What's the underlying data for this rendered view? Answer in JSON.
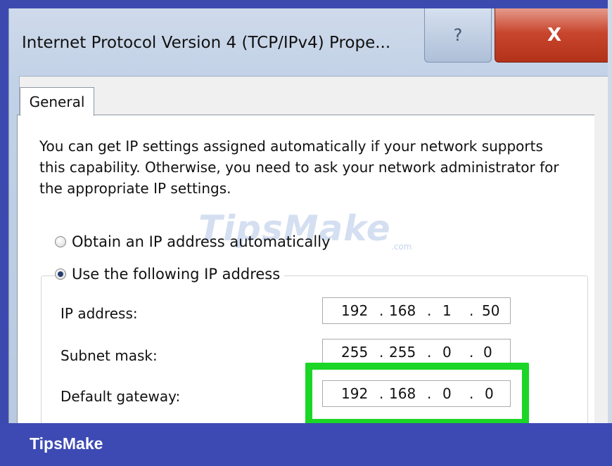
{
  "window": {
    "title": "Internet Protocol Version 4 (TCP/IPv4) Prope...",
    "help_glyph": "?",
    "close_glyph": "X"
  },
  "tabs": [
    {
      "label": "General",
      "selected": true
    }
  ],
  "description": "You can get IP settings assigned automatically if your network supports this capability. Otherwise, you need to ask your network administrator for the appropriate IP settings.",
  "radios": {
    "auto": {
      "label": "Obtain an IP address automatically",
      "checked": false
    },
    "manual": {
      "label": "Use the following IP address",
      "checked": true
    }
  },
  "fields": {
    "ip_address": {
      "label": "IP address:",
      "octets": [
        "192",
        "168",
        "1",
        "50"
      ]
    },
    "subnet_mask": {
      "label": "Subnet mask:",
      "octets": [
        "255",
        "255",
        "0",
        "0"
      ]
    },
    "default_gateway": {
      "label": "Default gateway:",
      "octets": [
        "192",
        "168",
        "0",
        "0"
      ]
    }
  },
  "separator": ".",
  "watermark": {
    "text": "TipsMake",
    "suffix": ".com"
  },
  "footer": {
    "brand": "TipsMake"
  },
  "colors": {
    "highlight": "#1bd626",
    "footer_bg": "#3d4ab3",
    "close_button": "#c8462e"
  }
}
